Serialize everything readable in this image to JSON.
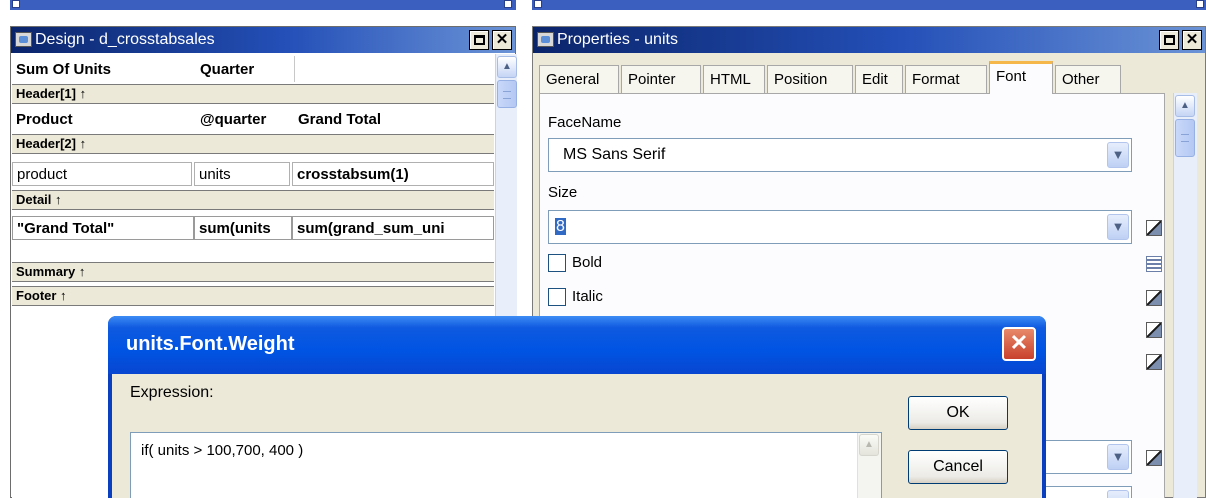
{
  "design_window": {
    "title": "Design - d_crosstabsales",
    "header_row": {
      "col1": "Sum Of Units",
      "col2": "Quarter"
    },
    "bands": {
      "header1": "Header[1] ↑",
      "header2": "Header[2] ↑",
      "detail": "Detail ↑",
      "summary": "Summary ↑",
      "footer": "Footer ↑"
    },
    "header1_row": {
      "col1": "Product",
      "col2": "@quarter",
      "col3": "Grand Total"
    },
    "header2_row": {
      "col1": "product",
      "col2": "units",
      "col3": "crosstabsum(1)"
    },
    "detail_row": {
      "col1": "\"Grand Total\"",
      "col2": "sum(units",
      "col3": "sum(grand_sum_uni"
    }
  },
  "properties_window": {
    "title": "Properties - units",
    "tabs": [
      {
        "label": "General"
      },
      {
        "label": "Pointer"
      },
      {
        "label": "HTML"
      },
      {
        "label": "Position"
      },
      {
        "label": "Edit"
      },
      {
        "label": "Format"
      },
      {
        "label": "Font"
      },
      {
        "label": "Other"
      }
    ],
    "active_tab": "Font",
    "facename_label": "FaceName",
    "facename_value": "MS Sans Serif",
    "size_label": "Size",
    "size_value": "8",
    "bold_label": "Bold",
    "italic_label": "Italic"
  },
  "dialog": {
    "title": "units.Font.Weight",
    "expression_label": "Expression:",
    "expression_value": "if( units > 100,700, 400 )",
    "ok_label": "OK",
    "cancel_label": "Cancel"
  },
  "colors": {
    "titlebar_start": "#0a246a",
    "titlebar_end": "#6b93d6",
    "dialog_titlebar": "#0054e3",
    "active_tab_accent": "#f5b64a",
    "face": "#ece9d8"
  },
  "icons": {
    "minimize_glyph": "_",
    "restore_glyph": "□",
    "close_glyph": "✕",
    "up_arrow": "▲",
    "down_arrow": "▼"
  }
}
